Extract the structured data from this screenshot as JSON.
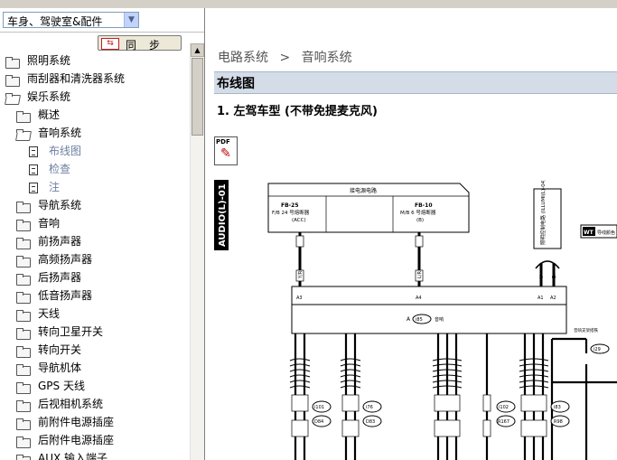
{
  "nav": {
    "combo_value": "车身、驾驶室&配件",
    "sync_label": "同步",
    "tree": [
      {
        "label": "照明系统",
        "type": "folder",
        "level": 0
      },
      {
        "label": "雨刮器和清洗器系统",
        "type": "folder",
        "level": 0
      },
      {
        "label": "娱乐系统",
        "type": "folder-open",
        "level": 0
      },
      {
        "label": "概述",
        "type": "folder",
        "level": 1
      },
      {
        "label": "音响系统",
        "type": "folder-open",
        "level": 1
      },
      {
        "label": "布线图",
        "type": "doc",
        "level": 2
      },
      {
        "label": "检查",
        "type": "doc",
        "level": 2
      },
      {
        "label": "注",
        "type": "doc",
        "level": 2
      },
      {
        "label": "导航系统",
        "type": "folder",
        "level": 1
      },
      {
        "label": "音响",
        "type": "folder",
        "level": 1
      },
      {
        "label": "前扬声器",
        "type": "folder",
        "level": 1
      },
      {
        "label": "高频扬声器",
        "type": "folder",
        "level": 1
      },
      {
        "label": "后扬声器",
        "type": "folder",
        "level": 1
      },
      {
        "label": "低音扬声器",
        "type": "folder",
        "level": 1
      },
      {
        "label": "天线",
        "type": "folder",
        "level": 1
      },
      {
        "label": "转向卫星开关",
        "type": "folder",
        "level": 1
      },
      {
        "label": "转向开关",
        "type": "folder",
        "level": 1
      },
      {
        "label": "导航机体",
        "type": "folder",
        "level": 1
      },
      {
        "label": "GPS 天线",
        "type": "folder",
        "level": 1
      },
      {
        "label": "后视相机系统",
        "type": "folder",
        "level": 1
      },
      {
        "label": "前附件电源插座",
        "type": "folder",
        "level": 1
      },
      {
        "label": "后附件电源插座",
        "type": "folder",
        "level": 1
      },
      {
        "label": "AUX 输入端子",
        "type": "folder",
        "level": 1
      }
    ]
  },
  "content": {
    "breadcrumb_1": "电路系统",
    "breadcrumb_sep": ">",
    "breadcrumb_2": "音响系统",
    "section_title": "布线图",
    "heading": "1. 左驾车型 (不带免提麦克风)",
    "pdf_label": "PDF",
    "diagram": {
      "code": "AUDIO(L)-01",
      "box_title": "接电源电路",
      "fb25": "FB-25",
      "fb25_sub": "F/B 24 号熔断器",
      "fb25_acc": "(ACC)",
      "fb10": "FB-10",
      "fb10_sub": "M/B 6 号熔断器",
      "fb10_b": "(B)",
      "illum_label": "照明控制电路 (ILLUMI(L)-04)",
      "wt": "WT",
      "wt_text": "导线颜色",
      "audio_conn": "A",
      "audio_id": "i85",
      "audio_name": "音响",
      "shield": "音响支架搭铁",
      "gnd": "i29",
      "conn_labels": [
        "i101",
        "D84",
        "i76",
        "D83",
        "i102",
        "R167",
        "i83",
        "R98"
      ],
      "wire_top": [
        "Y/R",
        "L/R",
        "V",
        "Br"
      ],
      "pins_top": [
        "A3",
        "A4",
        "A1",
        "A2"
      ]
    }
  }
}
